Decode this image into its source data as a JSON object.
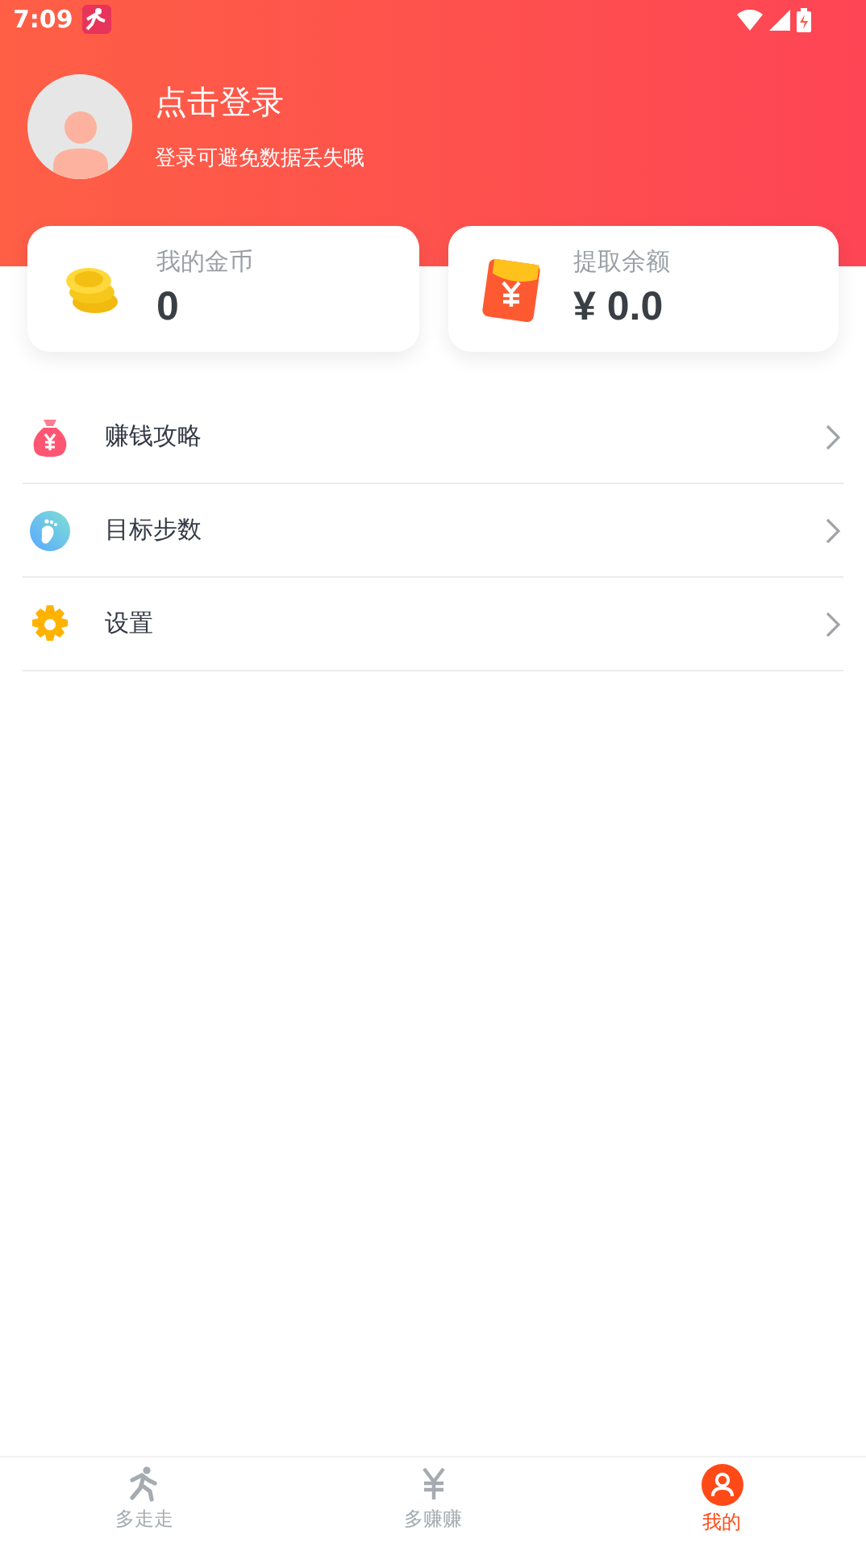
{
  "status_bar": {
    "time": "7:09"
  },
  "profile": {
    "title": "点击登录",
    "subtitle": "登录可避免数据丢失哦"
  },
  "cards": [
    {
      "kind": "coins",
      "label": "我的金币",
      "value": "0"
    },
    {
      "kind": "balance",
      "label": "提取余额",
      "value": "¥ 0.0"
    }
  ],
  "menu": [
    {
      "kind": "money",
      "label": "赚钱攻略"
    },
    {
      "kind": "steps",
      "label": "目标步数"
    },
    {
      "kind": "settings",
      "label": "设置"
    }
  ],
  "tabs": [
    {
      "kind": "walk",
      "label": "多走走",
      "selected": false
    },
    {
      "kind": "earn",
      "label": "多赚赚",
      "selected": false
    },
    {
      "kind": "me",
      "label": "我的",
      "selected": true
    }
  ]
}
